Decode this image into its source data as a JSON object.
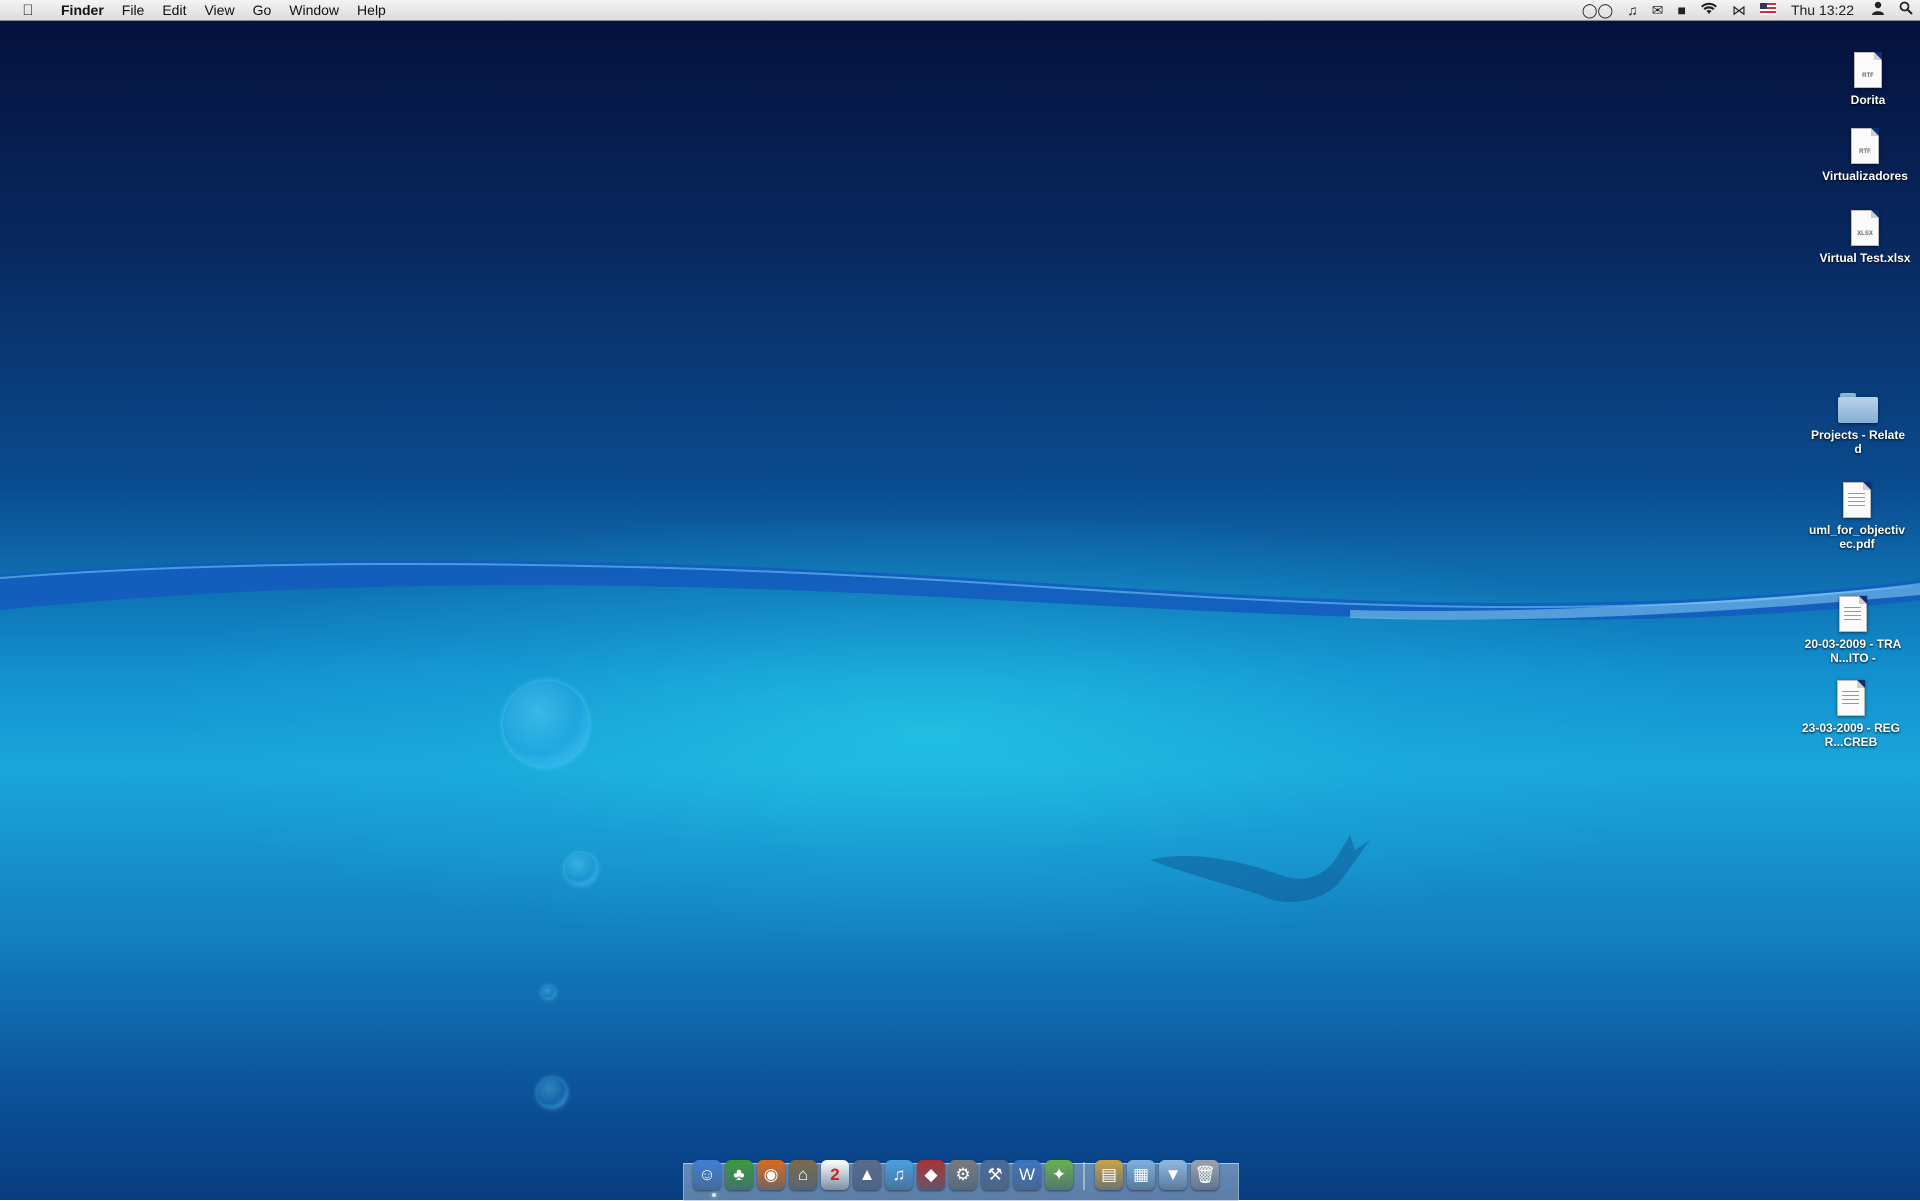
{
  "menubar": {
    "app_name": "Finder",
    "menus": [
      "File",
      "Edit",
      "View",
      "Go",
      "Window",
      "Help"
    ],
    "clock": "Thu 13:22",
    "status_icons": [
      "glasses-icon",
      "music-note-icon",
      "mail-icon",
      "growl-icon",
      "wifi-icon",
      "bluetooth-icon",
      "us-flag-icon",
      "user-icon",
      "spotlight-icon"
    ]
  },
  "desktop_icons": [
    {
      "label": "Dorita",
      "kind": "doc",
      "tag": "RTF"
    },
    {
      "label": "Virtualizadores",
      "kind": "doc",
      "tag": "RTF"
    },
    {
      "label": "Virtual Test.xlsx",
      "kind": "doc",
      "tag": "XLSX"
    },
    {
      "label": "Projects - Related",
      "kind": "folder"
    },
    {
      "label": "uml_for_objectivec.pdf",
      "kind": "doc",
      "tag": ""
    },
    {
      "label": "20-03-2009 - TRAN...ITO -",
      "kind": "doc",
      "tag": ""
    },
    {
      "label": "23-03-2009 - REG R...CREB",
      "kind": "doc",
      "tag": ""
    }
  ],
  "dock": {
    "apps": [
      {
        "name": "finder-icon",
        "glyph": "☺",
        "color": "#3f7fd6"
      },
      {
        "name": "adium-icon",
        "glyph": "♣",
        "color": "#3a9a3a"
      },
      {
        "name": "firefox-icon",
        "glyph": "◉",
        "color": "#d86b1c"
      },
      {
        "name": "museum-icon",
        "glyph": "⌂",
        "color": "#7a6a4a"
      },
      {
        "name": "ical-icon",
        "glyph": "2",
        "color": "#ffffff"
      },
      {
        "name": "iphoto-icon",
        "glyph": "▲",
        "color": "#5a6a8a"
      },
      {
        "name": "itunes-icon",
        "glyph": "♫",
        "color": "#4aa0e0"
      },
      {
        "name": "app-store-icon",
        "glyph": "◆",
        "color": "#a33"
      },
      {
        "name": "system-preferences-icon",
        "glyph": "⚙",
        "color": "#7a7a7a"
      },
      {
        "name": "xcode-icon",
        "glyph": "⚒",
        "color": "#4a6a9a"
      },
      {
        "name": "word-icon",
        "glyph": "W",
        "color": "#3c75c0"
      },
      {
        "name": "utility-icon",
        "glyph": "✦",
        "color": "#6ab04a"
      }
    ],
    "stacks": [
      {
        "name": "documents-stack-icon",
        "glyph": "▤",
        "color": "#c9a24a"
      },
      {
        "name": "applications-stack-icon",
        "glyph": "▦",
        "color": "#7fb0dd"
      },
      {
        "name": "downloads-stack-icon",
        "glyph": "▼",
        "color": "#8fb8e0"
      },
      {
        "name": "trash-icon",
        "glyph": "🗑",
        "color": "#9aa3ad"
      }
    ]
  }
}
